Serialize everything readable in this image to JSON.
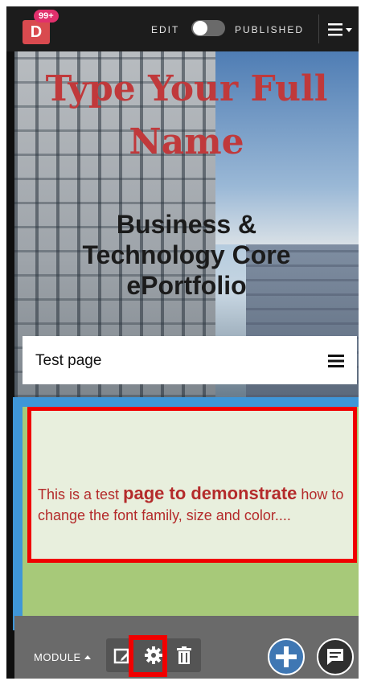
{
  "topbar": {
    "logo_letter": "D",
    "notification_count": "99+",
    "edit_label": "EDIT",
    "published_label": "PUBLISHED"
  },
  "hero": {
    "name_line1": "Type Your Full",
    "name_line2": "Name",
    "subtitle_line1": "Business &",
    "subtitle_line2": "Technology Core",
    "subtitle_line3": "ePortfolio"
  },
  "page_nav": {
    "title": "Test page"
  },
  "content": {
    "text_part1": "This is a test ",
    "text_bold": "page to demonstrate",
    "text_part2": " how to change the font family, size and color...."
  },
  "toolbar": {
    "module_label": "MODULE"
  },
  "colors": {
    "accent_red": "#c0393b",
    "highlight_red": "#f00000",
    "blue": "#3f96d8",
    "green": "#a7c979"
  }
}
